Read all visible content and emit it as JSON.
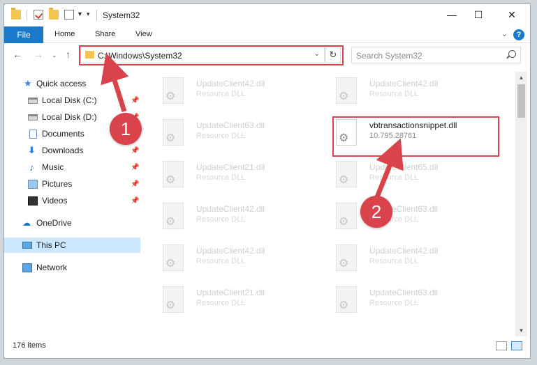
{
  "window": {
    "title": "System32",
    "controls": {
      "minimize": "—",
      "maximize": "☐",
      "close": "✕"
    }
  },
  "ribbon": {
    "tabs": [
      "File",
      "Home",
      "Share",
      "View"
    ],
    "help": "?"
  },
  "address": {
    "path": "C:\\Windows\\System32",
    "search_placeholder": "Search System32"
  },
  "navigation": {
    "items": [
      {
        "label": "Quick access",
        "icon": "star-icon",
        "pinned": false
      },
      {
        "label": "Local Disk (C:)",
        "icon": "drive-icon",
        "pinned": true
      },
      {
        "label": "Local Disk (D:)",
        "icon": "drive-icon",
        "pinned": true
      },
      {
        "label": "Documents",
        "icon": "documents-icon",
        "pinned": true
      },
      {
        "label": "Downloads",
        "icon": "download-icon",
        "pinned": true
      },
      {
        "label": "Music",
        "icon": "music-icon",
        "pinned": true
      },
      {
        "label": "Pictures",
        "icon": "pictures-icon",
        "pinned": true
      },
      {
        "label": "Videos",
        "icon": "videos-icon",
        "pinned": true
      },
      {
        "label": "OneDrive",
        "icon": "cloud-icon",
        "pinned": false
      },
      {
        "label": "This PC",
        "icon": "computer-icon",
        "pinned": false,
        "selected": true
      },
      {
        "label": "Network",
        "icon": "network-icon",
        "pinned": false
      }
    ]
  },
  "files": {
    "left": [
      {
        "name": "UpdateClient42.dll",
        "type": "Resource DLL"
      },
      {
        "name": "UpdateClient63.dll",
        "type": "Resource DLL"
      },
      {
        "name": "UpdateClient21.dll",
        "type": "Resource DLL"
      },
      {
        "name": "UpdateClient42.dll",
        "type": "Resource DLL"
      },
      {
        "name": "UpdateClient42.dll",
        "type": "Resource DLL"
      },
      {
        "name": "UpdateClient21.dll",
        "type": "Resource DLL"
      }
    ],
    "right": [
      {
        "name": "UpdateClient42.dll",
        "type": "Resource DLL"
      },
      {
        "name": "vbtransactionsnippet.dll",
        "type": "10.795.28761",
        "focused": true
      },
      {
        "name": "UpdateClient65.dll",
        "type": "Resource DLL"
      },
      {
        "name": "UpdateClient63.dll",
        "type": "Resource DLL"
      },
      {
        "name": "UpdateClient42.dll",
        "type": "Resource DLL"
      },
      {
        "name": "UpdateClient63.dll",
        "type": "Resource DLL"
      }
    ]
  },
  "status": {
    "items_count": "176 items"
  },
  "annotations": {
    "step1": "1",
    "step2": "2",
    "color": "#d9434b"
  }
}
